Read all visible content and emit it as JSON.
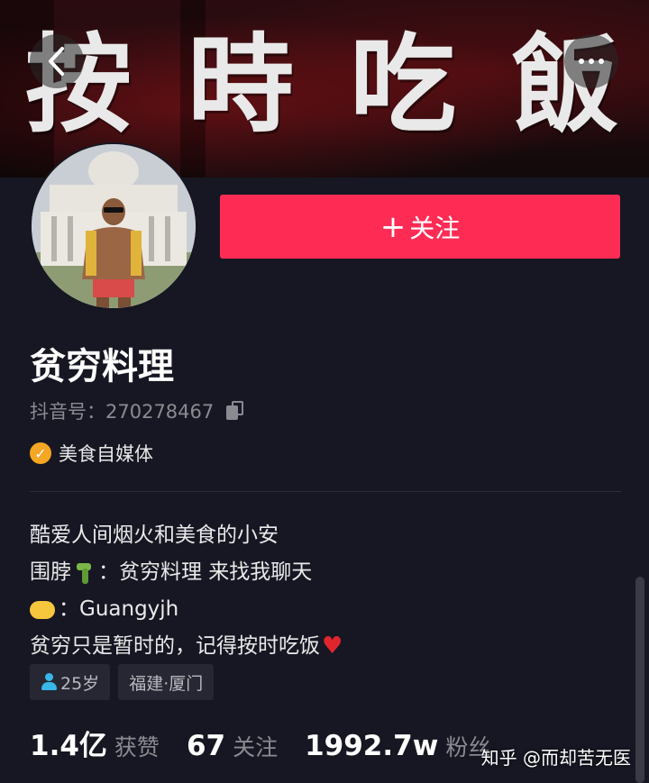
{
  "banner": {
    "title_chars": [
      "按",
      "時",
      "吃",
      "飯"
    ]
  },
  "header": {
    "back_icon": "chevron-left-icon",
    "more_icon": "more-dots-icon"
  },
  "profile": {
    "name": "贫穷料理",
    "douyin_id": "抖音号：270278467",
    "verified_label": "美食自媒体",
    "follow_label": "关注"
  },
  "bio": {
    "line1": "酷爱人间烟火和美食的小安",
    "line2_prefix": "围脖",
    "line2_suffix": "：贫穷料理 来找我聊天",
    "line3": "：Guangyjh",
    "line4": "贫穷只是暂时的，记得按时吃饭"
  },
  "tags": {
    "age": "25岁",
    "location": "福建·厦门"
  },
  "stats": {
    "likes_value": "1.4亿",
    "likes_label": "获赞",
    "following_value": "67",
    "following_label": "关注",
    "followers_value": "1992.7w",
    "followers_label": "粉丝"
  },
  "watermark": "知乎 @而却苦无医",
  "colors": {
    "accent": "#fe2c55",
    "background": "#161722",
    "badge": "#f5a623",
    "muted_text": "#8a8b91"
  }
}
